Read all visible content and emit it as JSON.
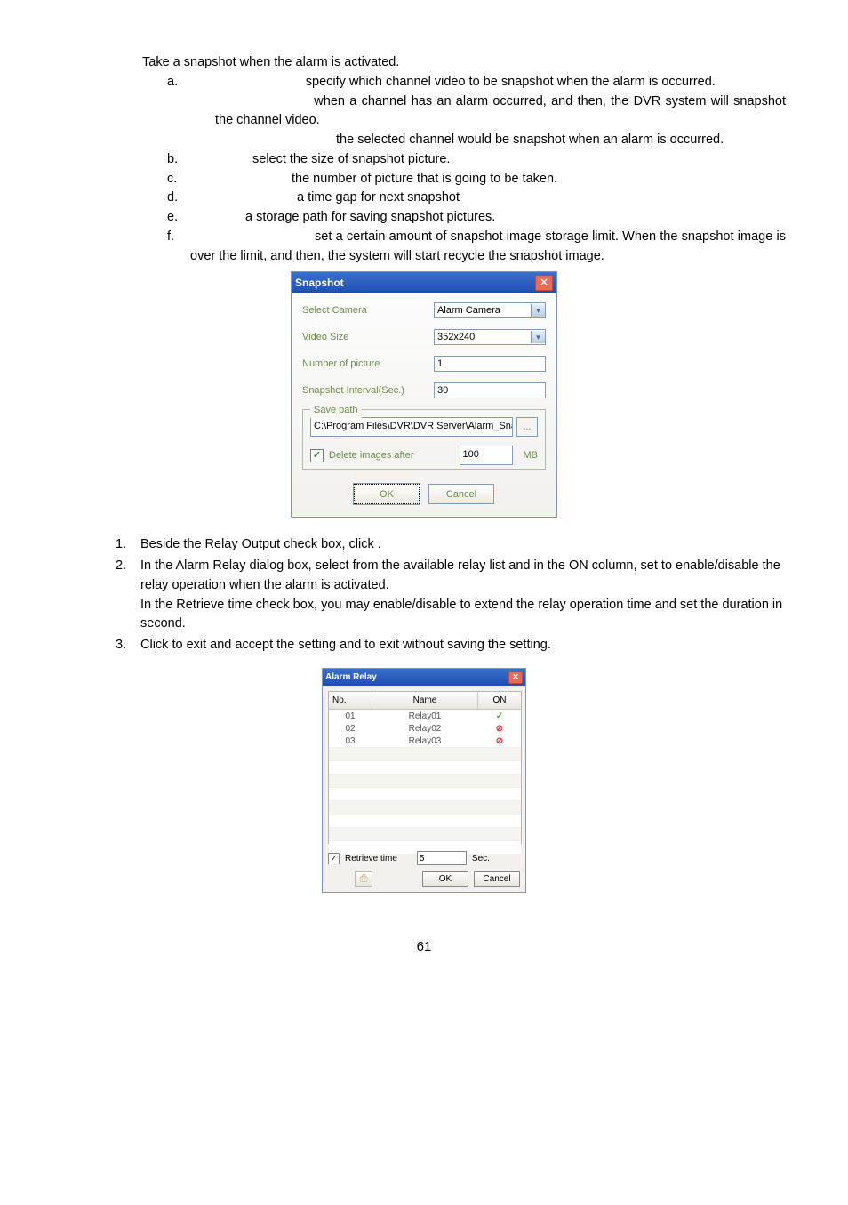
{
  "page_number": "61",
  "intro_line": "Take a snapshot when the alarm is activated.",
  "items": {
    "a": {
      "letter": "a.",
      "text": "specify which channel video to be snapshot when the alarm is occurred.",
      "sub1": "when a channel has an alarm occurred, and then, the DVR system will snapshot the channel video.",
      "sub2": "the selected channel would be snapshot when an alarm is occurred."
    },
    "b": {
      "letter": "b.",
      "text": "select the size of snapshot picture."
    },
    "c": {
      "letter": "c.",
      "text": "the number of picture that is going to be taken."
    },
    "d": {
      "letter": "d.",
      "text": "a time gap for next snapshot"
    },
    "e": {
      "letter": "e.",
      "text": "a storage path for saving snapshot pictures."
    },
    "f": {
      "letter": "f.",
      "text": "set a certain amount of snapshot image storage limit. When the snapshot image is over the limit, and then, the system will start recycle the snapshot image."
    }
  },
  "snapshot_dialog": {
    "title": "Snapshot",
    "labels": {
      "select_camera": "Select Camera",
      "video_size": "Video Size",
      "num_picture": "Number of picture",
      "interval": "Snapshot Interval(Sec.)",
      "save_path": "Save path",
      "delete_after": "Delete images after",
      "mb": "MB"
    },
    "values": {
      "select_camera": "Alarm Camera",
      "video_size": "352x240",
      "num_picture": "1",
      "interval": "30",
      "path": "C:\\Program Files\\DVR\\DVR Server\\Alarm_Sna",
      "delete_limit": "100"
    },
    "buttons": {
      "browse": "...",
      "ok": "OK",
      "cancel": "Cancel"
    }
  },
  "numbered": {
    "n1": {
      "num": "1.",
      "text": "Beside the Relay Output check box, click            ."
    },
    "n2": {
      "num": "2.",
      "text1": "In the Alarm Relay dialog box, select from the available relay list and in the ON column, set to enable/disable the relay operation when the alarm is activated.",
      "text2": "In the Retrieve time check box, you may enable/disable to extend the relay operation time and set the duration in second."
    },
    "n3": {
      "num": "3.",
      "text": "Click         to exit and accept the setting and                 to exit without saving the setting."
    }
  },
  "relay_dialog": {
    "title": "Alarm Relay",
    "headers": {
      "no": "No.",
      "name": "Name",
      "on": "ON"
    },
    "rows": [
      {
        "no": "01",
        "name": "Relay01",
        "on": "check"
      },
      {
        "no": "02",
        "name": "Relay02",
        "on": "no"
      },
      {
        "no": "03",
        "name": "Relay03",
        "on": "no"
      }
    ],
    "retrieve_label": "Retrieve time",
    "retrieve_value": "5",
    "sec": "Sec.",
    "buttons": {
      "ok": "OK",
      "cancel": "Cancel"
    }
  }
}
